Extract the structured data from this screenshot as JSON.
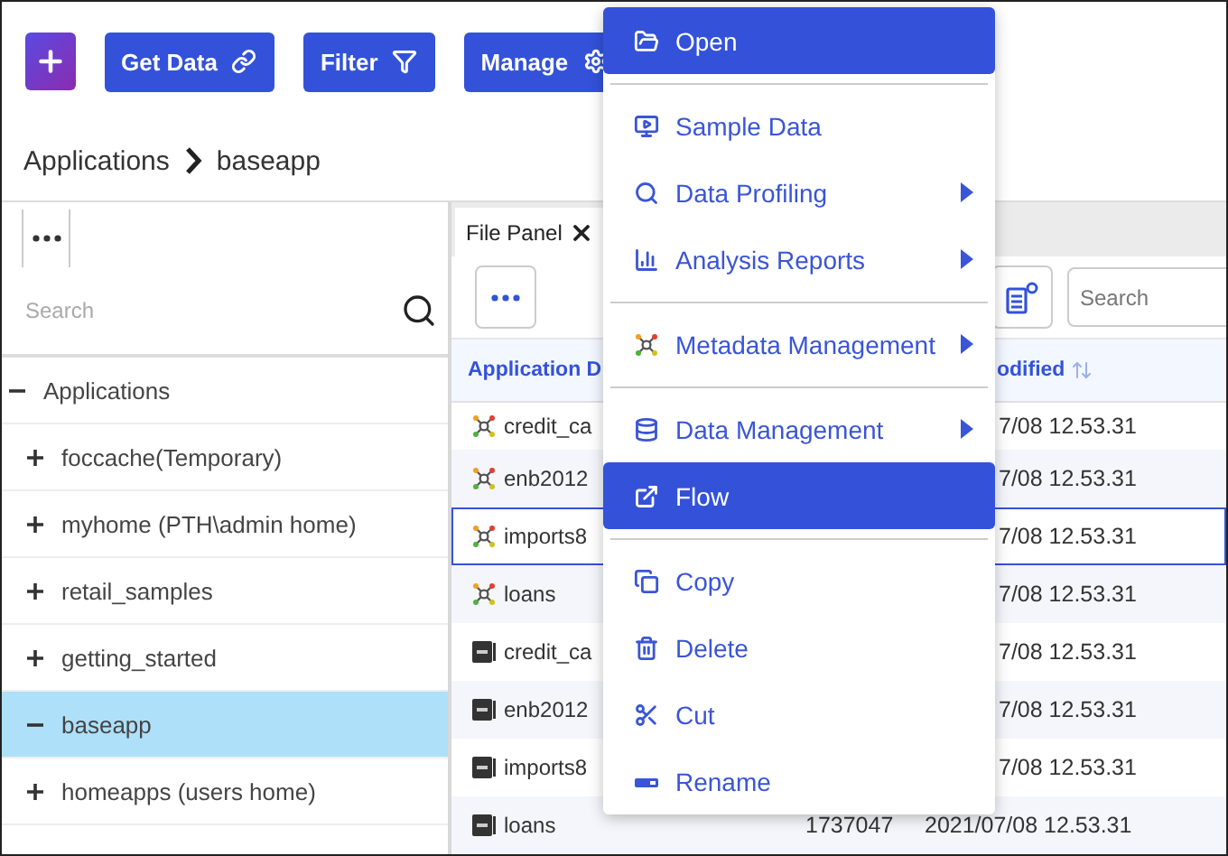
{
  "toolbar": {
    "buttons": [
      {
        "label": "Get Data"
      },
      {
        "label": "Filter"
      },
      {
        "label": "Manage"
      }
    ]
  },
  "breadcrumb": [
    "Applications",
    "baseapp"
  ],
  "left_panel": {
    "search": {
      "placeholder": "Search"
    },
    "tree": [
      {
        "label": "Applications",
        "expanded": true,
        "selected": false,
        "children": [
          {
            "label": "foccache(Temporary)",
            "expanded": false,
            "selected": false
          },
          {
            "label": "myhome (PTH\\admin home)",
            "expanded": false,
            "selected": false
          },
          {
            "label": "retail_samples",
            "expanded": false,
            "selected": false
          },
          {
            "label": "getting_started",
            "expanded": false,
            "selected": false
          },
          {
            "label": "baseapp",
            "expanded": true,
            "selected": true
          },
          {
            "label": "homeapps (users home)",
            "expanded": false,
            "selected": false
          }
        ]
      }
    ]
  },
  "file_panel": {
    "tab": {
      "label": "File Panel",
      "selected": true
    },
    "search": {
      "placeholder": "Search"
    },
    "table": {
      "columns": [
        "Application D",
        "odified"
      ],
      "rows": [
        {
          "kind": "flow",
          "name": "credit_ca",
          "date": "7/08 12.53.31",
          "selected": false
        },
        {
          "kind": "flow",
          "name": "enb2012",
          "date": "7/08 12.53.31",
          "selected": false
        },
        {
          "kind": "flow",
          "name": "imports8",
          "date": "7/08 12.53.31",
          "selected": true
        },
        {
          "kind": "flow",
          "name": "loans",
          "date": "7/08 12.53.31",
          "selected": false
        },
        {
          "kind": "csv",
          "name": "credit_ca",
          "date": "7/08 12.53.31",
          "selected": false
        },
        {
          "kind": "csv",
          "name": "enb2012",
          "date": "7/08 12.53.31",
          "selected": false
        },
        {
          "kind": "csv",
          "name": "imports8",
          "date": "7/08 12.53.31",
          "selected": false
        },
        {
          "kind": "csv",
          "name": "loans",
          "size": "1737047",
          "date": "2021/07/08 12.53.31",
          "selected": false
        }
      ]
    }
  },
  "context_menu": {
    "groups": [
      [
        {
          "label": "Open",
          "selected": true,
          "submenu": false
        }
      ],
      [
        {
          "label": "Sample Data",
          "selected": false,
          "submenu": false
        },
        {
          "label": "Data Profiling",
          "selected": false,
          "submenu": true
        },
        {
          "label": "Analysis Reports",
          "selected": false,
          "submenu": true
        }
      ],
      [
        {
          "label": "Metadata Management",
          "selected": false,
          "submenu": true
        }
      ],
      [
        {
          "label": "Data Management",
          "selected": false,
          "submenu": true
        },
        {
          "label": "Flow",
          "selected": true,
          "submenu": false
        }
      ],
      [
        {
          "label": "Copy",
          "selected": false,
          "submenu": false
        },
        {
          "label": "Delete",
          "selected": false,
          "submenu": false
        },
        {
          "label": "Cut",
          "selected": false,
          "submenu": false
        },
        {
          "label": "Rename",
          "selected": false,
          "submenu": false
        }
      ]
    ]
  }
}
